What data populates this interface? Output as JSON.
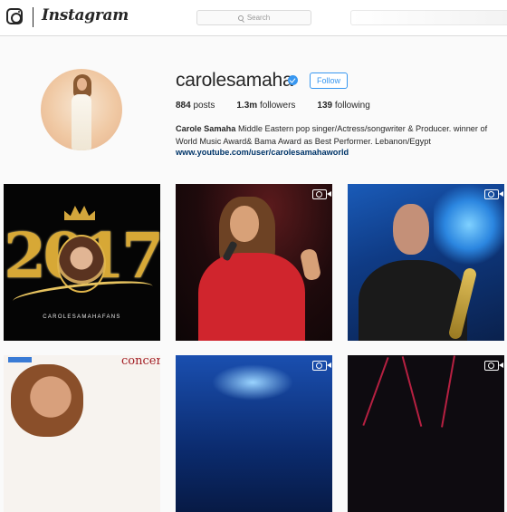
{
  "topbar": {
    "brand": "Instagram",
    "search_placeholder": "Search",
    "icons": [
      "instagram-logo-icon",
      "search-icon"
    ]
  },
  "profile": {
    "username": "carolesamaha",
    "verified": true,
    "follow_label": "Follow",
    "stats": {
      "posts_value": "884",
      "posts_label": "posts",
      "followers_value": "1.3m",
      "followers_label": "followers",
      "following_value": "139",
      "following_label": "following"
    },
    "bio_name": "Carole Samaha",
    "bio_text": " Middle Eastern pop singer/Actress/songwriter & Producer. winner of World Music Award& Bama Award as Best Performer. Lebanon/Egypt",
    "link": "www.youtube.com/user/carolesamahaworld"
  },
  "posts": {
    "tile1_year": "2017",
    "tile1_caption": "CAROLESAMAHAFANS",
    "tile4_caption": "concert",
    "video_icon": "video-camera-icon"
  },
  "colors": {
    "accent": "#3897f0",
    "link": "#003569",
    "background": "#fafafa",
    "border": "#dbdbdb"
  }
}
